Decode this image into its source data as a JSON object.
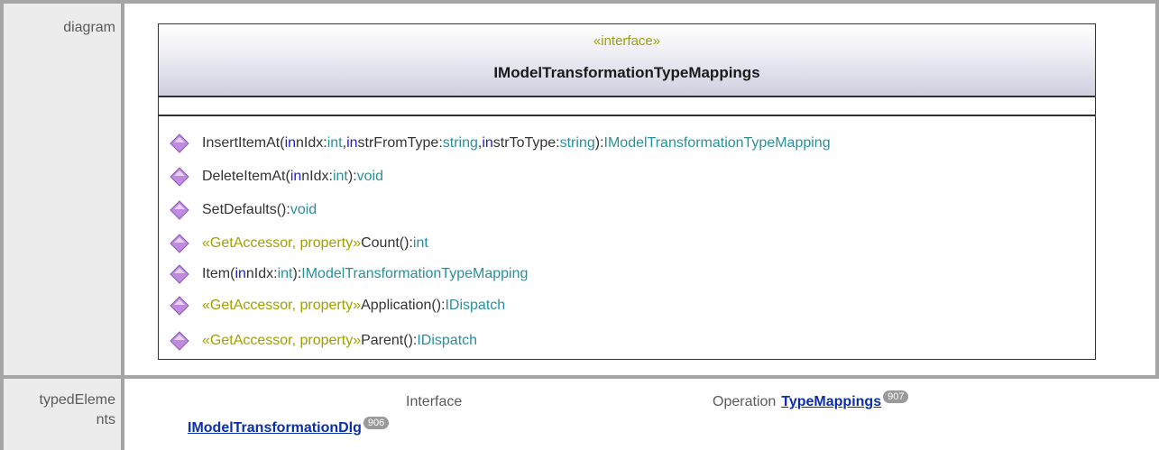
{
  "labels": {
    "diagram": "diagram",
    "typed_elements": "typedElements"
  },
  "uml": {
    "stereotype": "«interface»",
    "name": "IModelTransformationTypeMappings",
    "operations_icon": "diamond-operation-icon",
    "colors": {
      "keyword": "#2222bb",
      "type": "#2a8f9c",
      "stereotype": "#a0a000",
      "icon": "#c08ae0"
    },
    "operations": [
      {
        "name": "InsertItemAt(",
        "in1": "in",
        "p1": " nIdx:",
        "t1": "int",
        "sep1": ", ",
        "in2": "in",
        "p2": " strFromType:",
        "t2": "string",
        "sep2": ", ",
        "in3": "in",
        "p3": " strToType:",
        "t3": "string",
        "close": "):",
        "ret": "IModelTransformationTypeMapping"
      },
      {
        "name": "DeleteItemAt(",
        "in1": "in",
        "p1": " nIdx:",
        "t1": "int",
        "close": "):",
        "ret": "void"
      },
      {
        "name": "SetDefaults():",
        "ret": "void"
      },
      {
        "stereo": "«GetAccessor, property»",
        "name": " Count():",
        "ret": "int"
      },
      {
        "name": "Item(",
        "in1": "in",
        "p1": " nIdx:",
        "t1": "int",
        "close": "):",
        "ret": "IModelTransformationTypeMapping"
      },
      {
        "stereo": "«GetAccessor, property»",
        "name": " Application():",
        "ret": "IDispatch"
      },
      {
        "stereo": "«GetAccessor, property»",
        "name": " Parent():",
        "ret": "IDispatch"
      }
    ]
  },
  "typed_elements": {
    "interface_label": "Interface",
    "interface_link": "IModelTransformationDlg",
    "interface_badge": "906",
    "operation_label": "Operation",
    "operation_link": "TypeMappings",
    "operation_badge": "907"
  }
}
